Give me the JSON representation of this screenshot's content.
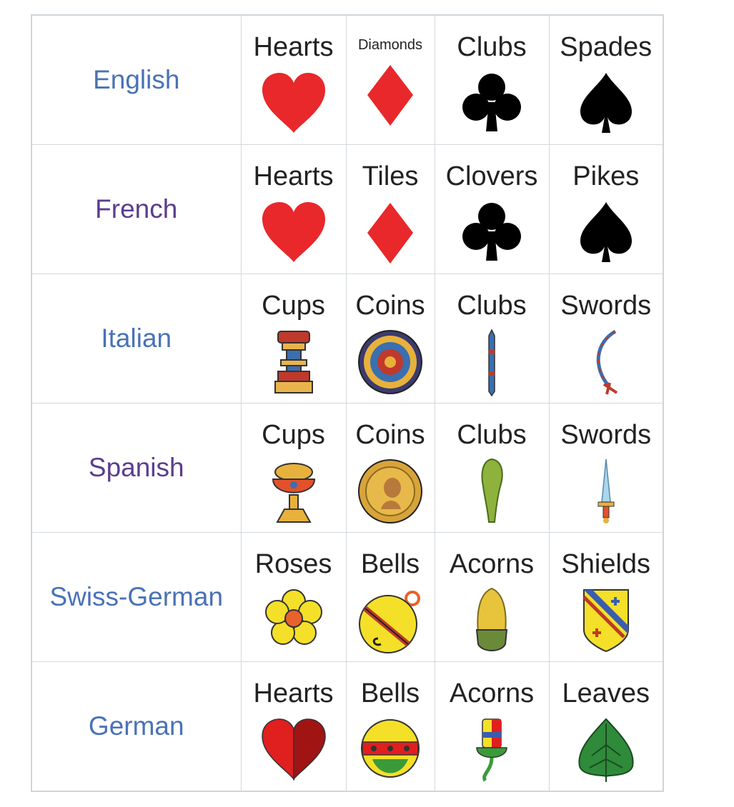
{
  "colors": {
    "language_blue": "#4a72b6",
    "language_purple": "#5b3d8f",
    "red_suit": "#e8282b",
    "black_suit": "#000000"
  },
  "rows": [
    {
      "language": "English",
      "language_color": "blue",
      "suits": [
        {
          "name": "Hearts",
          "icon": "heart-icon"
        },
        {
          "name": "Diamonds",
          "icon": "diamond-icon"
        },
        {
          "name": "Clubs",
          "icon": "club-icon"
        },
        {
          "name": "Spades",
          "icon": "spade-icon"
        }
      ]
    },
    {
      "language": "French",
      "language_color": "purple",
      "suits": [
        {
          "name": "Hearts",
          "icon": "heart-icon"
        },
        {
          "name": "Tiles",
          "icon": "diamond-icon"
        },
        {
          "name": "Clovers",
          "icon": "club-icon"
        },
        {
          "name": "Pikes",
          "icon": "spade-icon"
        }
      ]
    },
    {
      "language": "Italian",
      "language_color": "blue",
      "suits": [
        {
          "name": "Cups",
          "icon": "italian-cup-icon"
        },
        {
          "name": "Coins",
          "icon": "italian-coin-icon"
        },
        {
          "name": "Clubs",
          "icon": "italian-club-icon"
        },
        {
          "name": "Swords",
          "icon": "italian-sword-icon"
        }
      ]
    },
    {
      "language": "Spanish",
      "language_color": "purple",
      "suits": [
        {
          "name": "Cups",
          "icon": "spanish-cup-icon"
        },
        {
          "name": "Coins",
          "icon": "spanish-coin-icon"
        },
        {
          "name": "Clubs",
          "icon": "spanish-club-icon"
        },
        {
          "name": "Swords",
          "icon": "spanish-sword-icon"
        }
      ]
    },
    {
      "language": "Swiss-German",
      "language_color": "blue",
      "suits": [
        {
          "name": "Roses",
          "icon": "rose-icon"
        },
        {
          "name": "Bells",
          "icon": "swiss-bell-icon"
        },
        {
          "name": "Acorns",
          "icon": "swiss-acorn-icon"
        },
        {
          "name": "Shields",
          "icon": "shield-icon"
        }
      ]
    },
    {
      "language": "German",
      "language_color": "blue",
      "suits": [
        {
          "name": "Hearts",
          "icon": "german-heart-icon"
        },
        {
          "name": "Bells",
          "icon": "german-bell-icon"
        },
        {
          "name": "Acorns",
          "icon": "german-acorn-icon"
        },
        {
          "name": "Leaves",
          "icon": "leaf-icon"
        }
      ]
    }
  ]
}
